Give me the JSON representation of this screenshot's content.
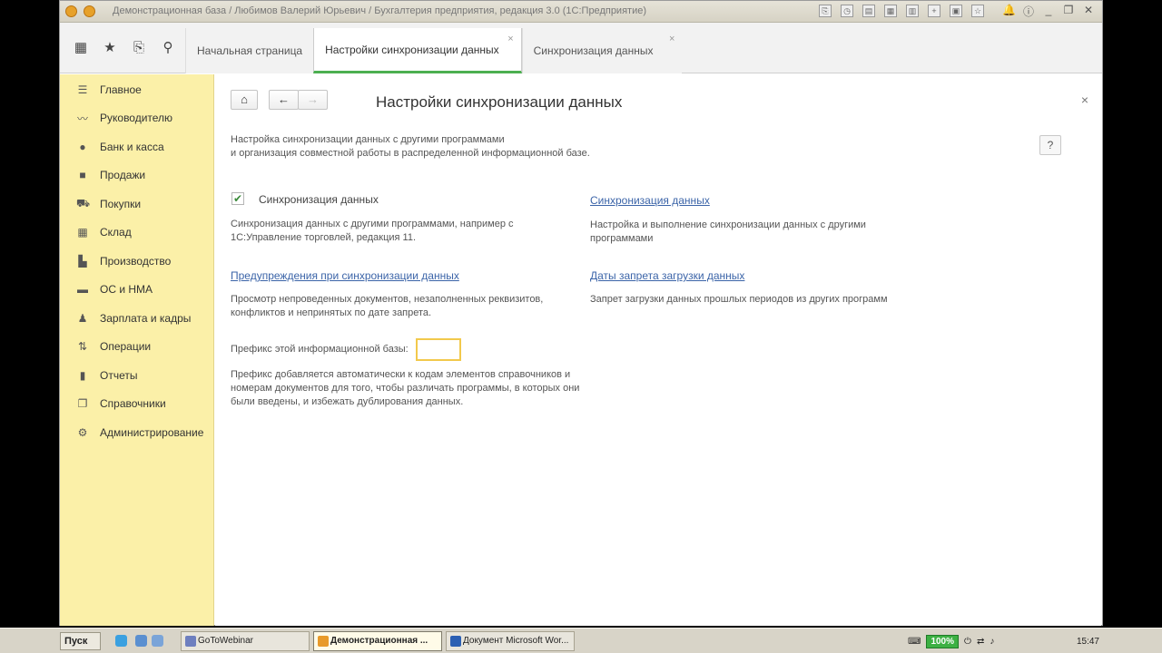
{
  "window": {
    "title": "Демонстрационная база / Любимов Валерий Юрьевич / Бухгалтерия предприятия, редакция 3.0  (1С:Предприятие)"
  },
  "tabs": [
    {
      "label": "Начальная страница"
    },
    {
      "label": "Настройки синхронизации данных"
    },
    {
      "label": "Синхронизация данных"
    }
  ],
  "sidebar": {
    "items": [
      {
        "label": "Главное",
        "icon": "list-icon"
      },
      {
        "label": "Руководителю",
        "icon": "chart-icon"
      },
      {
        "label": "Банк и касса",
        "icon": "coins-icon"
      },
      {
        "label": "Продажи",
        "icon": "bag-icon"
      },
      {
        "label": "Покупки",
        "icon": "cart-icon"
      },
      {
        "label": "Склад",
        "icon": "warehouse-icon"
      },
      {
        "label": "Производство",
        "icon": "factory-icon"
      },
      {
        "label": "ОС и НМА",
        "icon": "truck-icon"
      },
      {
        "label": "Зарплата и кадры",
        "icon": "person-icon"
      },
      {
        "label": "Операции",
        "icon": "operations-icon"
      },
      {
        "label": "Отчеты",
        "icon": "report-icon"
      },
      {
        "label": "Справочники",
        "icon": "book-icon"
      },
      {
        "label": "Администрирование",
        "icon": "gear-icon"
      }
    ]
  },
  "page": {
    "title": "Настройки синхронизации данных",
    "intro_line1": "Настройка синхронизации данных с другими программами",
    "intro_line2": "и организация совместной работы в распределенной информационной базе.",
    "sync_checkbox_label": "Синхронизация данных",
    "sync_checked": true,
    "sync_desc": "Синхронизация данных с другими программами, например с 1С:Управление торговлей, редакция 11.",
    "warnings_link": "Предупреждения при синхронизации данных",
    "warnings_desc": "Просмотр непроведенных документов, незаполненных реквизитов, конфликтов и непринятых по дате запрета.",
    "prefix_label": "Префикс этой информационной базы:",
    "prefix_value": "",
    "prefix_desc": "Префикс добавляется автоматически к кодам элементов справочников и номерам документов для того, чтобы различать программы, в которых они были введены, и избежать дублирования данных.",
    "sync_link": "Синхронизация данных",
    "sync_link_desc": "Настройка и выполнение синхронизации данных с другими программами",
    "dates_link": "Даты запрета загрузки данных",
    "dates_desc": "Запрет загрузки данных прошлых периодов из других программ"
  },
  "taskbar": {
    "start_label": "Пуск",
    "tasks": [
      {
        "label": "GoToWebinar"
      },
      {
        "label": "Демонстрационная ..."
      },
      {
        "label": "Документ Microsoft Wor..."
      }
    ],
    "battery": "100%",
    "clock": "15:47"
  },
  "colors": {
    "sidebar_bg": "#fbf0a8",
    "link": "#3b64a8",
    "active_tab_underline": "#4caf50",
    "prefix_border": "#f2c94c"
  }
}
